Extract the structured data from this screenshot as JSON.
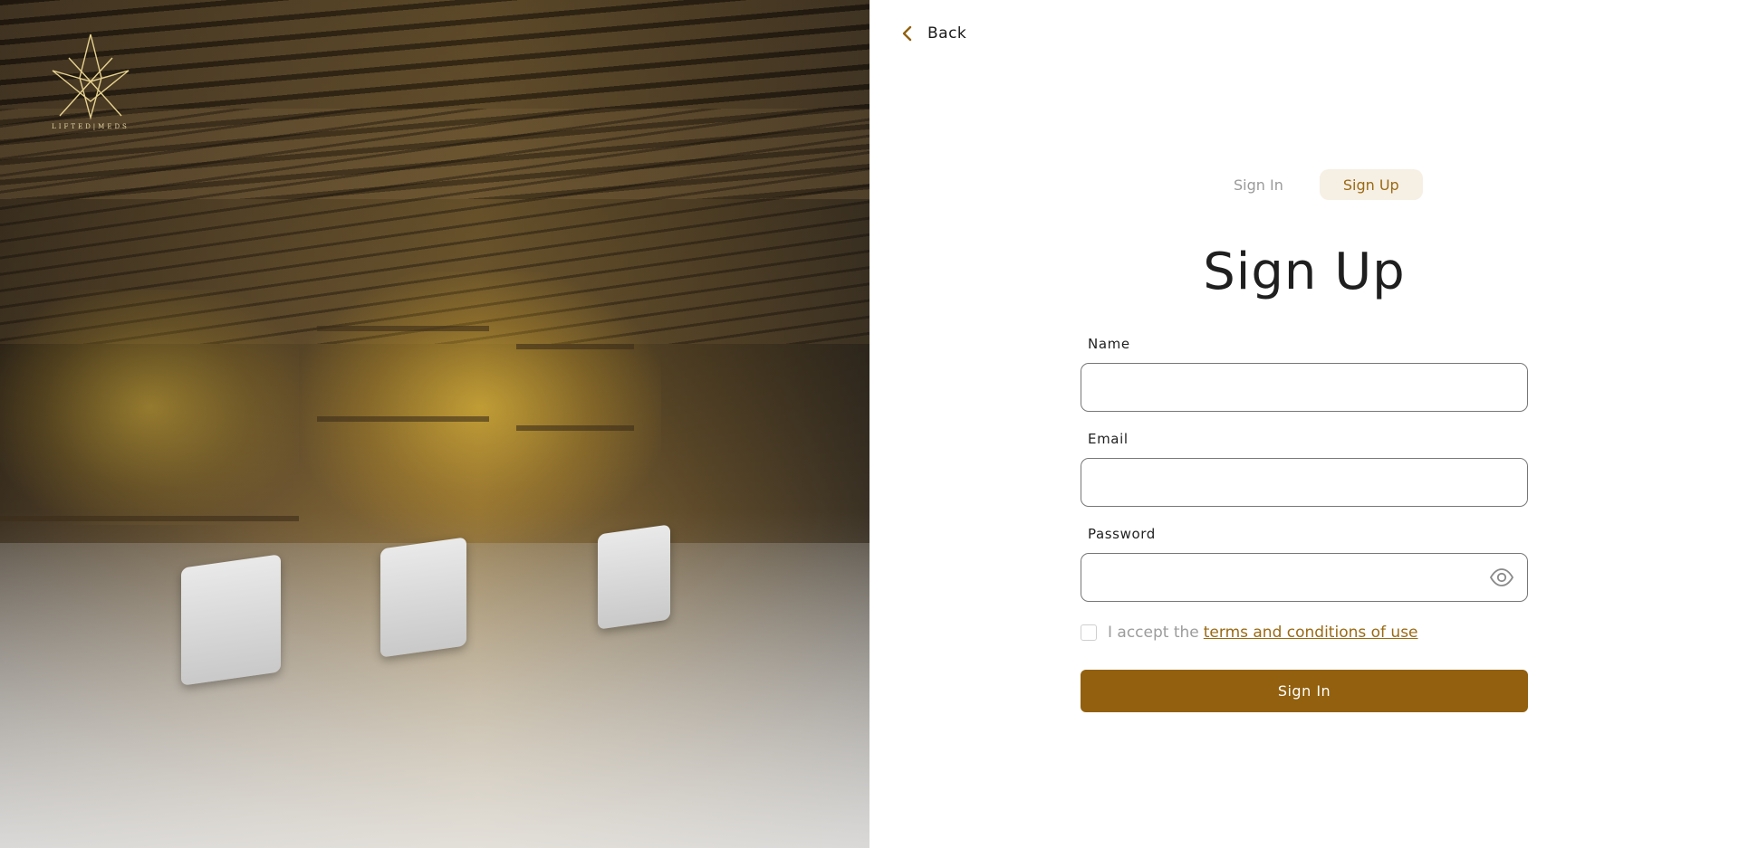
{
  "brand": {
    "logo_text": "LIFTED|MEDS",
    "accent_color": "#92600e",
    "accent_light": "#f6efe4"
  },
  "header": {
    "back_label": "Back"
  },
  "tabs": [
    {
      "label": "Sign In",
      "active": false
    },
    {
      "label": "Sign Up",
      "active": true
    }
  ],
  "form": {
    "title": "Sign Up",
    "fields": {
      "name": {
        "label": "Name",
        "value": "",
        "placeholder": ""
      },
      "email": {
        "label": "Email",
        "value": "",
        "placeholder": ""
      },
      "password": {
        "label": "Password",
        "value": "",
        "placeholder": ""
      }
    },
    "terms": {
      "prefix": "I accept the",
      "link_text": "terms and conditions of use",
      "checked": false
    },
    "submit_label": "Sign In"
  },
  "icons": {
    "back": "chevron-left-icon",
    "password_toggle": "eye-icon",
    "logo": "star-logo-icon"
  }
}
